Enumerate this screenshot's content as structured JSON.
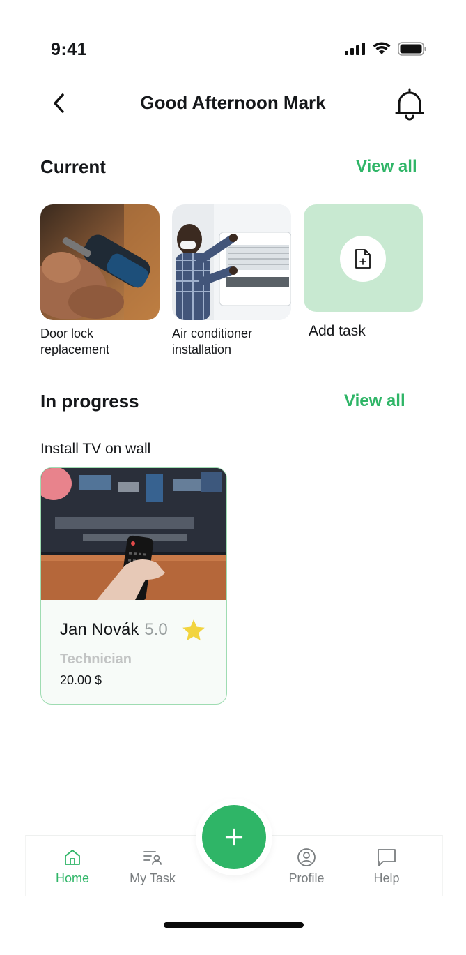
{
  "status_bar": {
    "time": "9:41"
  },
  "header": {
    "title": "Good Afternoon Mark"
  },
  "current": {
    "title": "Current",
    "view_all": "View all",
    "items": [
      {
        "label": "Door lock replacement"
      },
      {
        "label": "Air conditioner installation"
      }
    ],
    "add_task_label": "Add task"
  },
  "in_progress": {
    "title": "In progress",
    "view_all": "View all",
    "task_title": "Install TV on wall",
    "technician": {
      "name": "Jan Novák",
      "rating": "5.0",
      "role": "Technician",
      "price": "20.00 $"
    }
  },
  "nav": {
    "items": [
      {
        "label": "Home",
        "icon": "home-icon",
        "active": true
      },
      {
        "label": "My Task",
        "icon": "task-list-icon"
      },
      {
        "label": "Profile",
        "icon": "profile-icon"
      },
      {
        "label": "Help",
        "icon": "chat-icon"
      }
    ]
  },
  "colors": {
    "accent": "#2fb567",
    "accent_light": "#c8e9d1",
    "star": "#f2d43f"
  }
}
